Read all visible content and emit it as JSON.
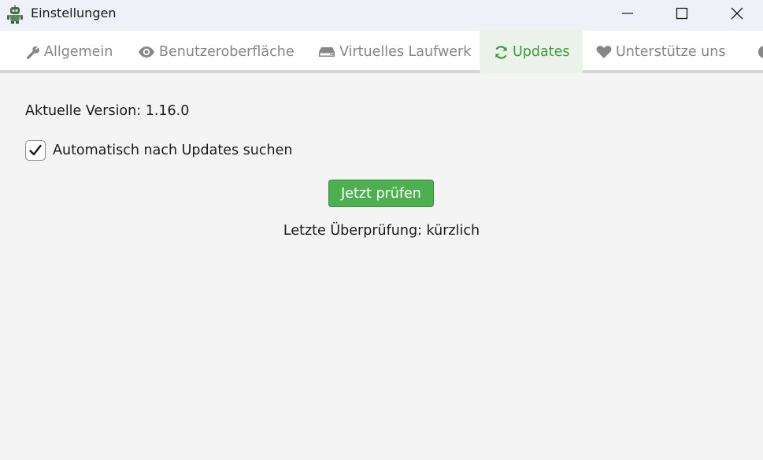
{
  "window": {
    "title": "Einstellungen",
    "app_icon": "robot-app-icon",
    "controls": [
      "minimize-icon",
      "maximize-icon",
      "close-icon"
    ]
  },
  "tabs": [
    {
      "label": "Allgemein",
      "icon": "wrench-icon",
      "active": false
    },
    {
      "label": "Benutzeroberfläche",
      "icon": "eye-icon",
      "active": false
    },
    {
      "label": "Virtuelles Laufwerk",
      "icon": "drive-icon",
      "active": false
    },
    {
      "label": "Updates",
      "icon": "refresh-icon",
      "active": true
    },
    {
      "label": "Unterstütze uns",
      "icon": "heart-icon",
      "active": false
    }
  ],
  "updates": {
    "current_version": "Aktuelle Version: 1.16.0",
    "auto_check_label": "Automatisch nach Updates suchen",
    "auto_check_checked": true,
    "check_now_label": "Jetzt prüfen",
    "last_check": "Letzte Überprüfung: kürzlich"
  },
  "colors": {
    "accent": "#43a047",
    "button_bg": "#4caf50",
    "tab_inactive_text": "#868686",
    "tab_active_text": "#3f9c3f"
  }
}
